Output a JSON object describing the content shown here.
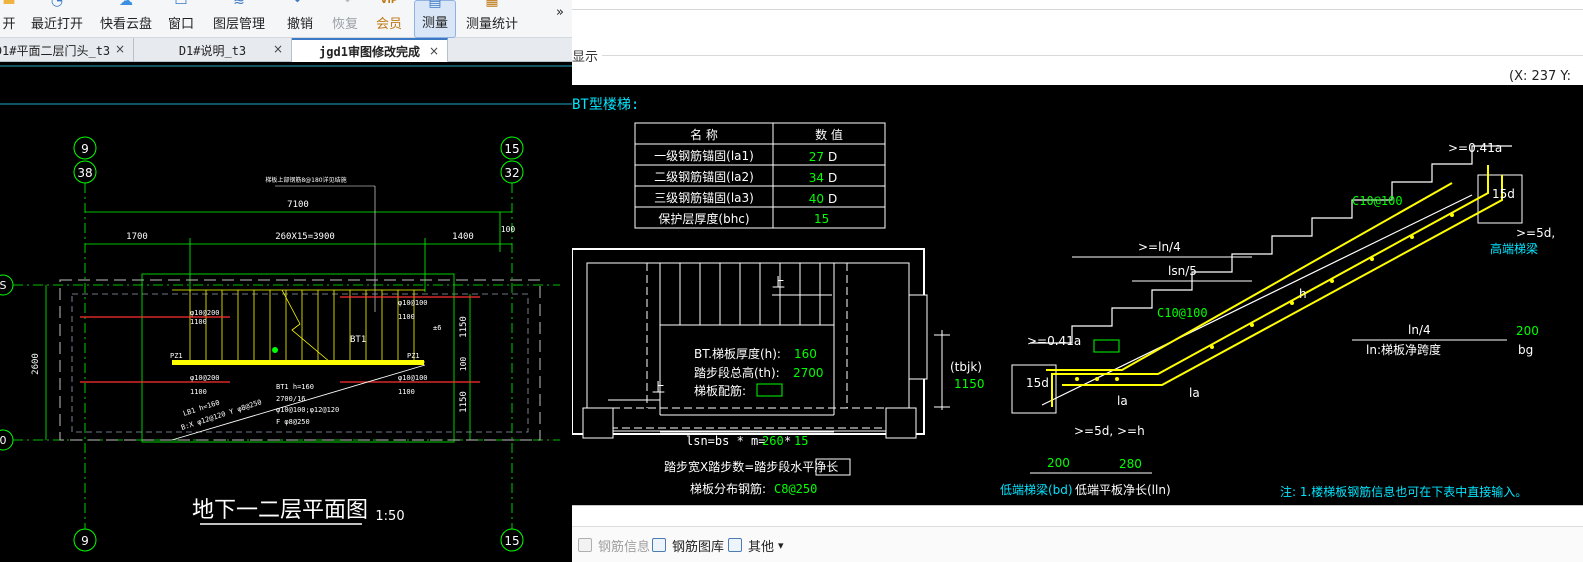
{
  "cad_viewer": {
    "toolbar": {
      "buttons": [
        {
          "id": "open",
          "label": "开",
          "icon": "folder-open-icon"
        },
        {
          "id": "recent",
          "label": "最近打开",
          "icon": "clock-icon"
        },
        {
          "id": "cloud",
          "label": "快看云盘",
          "icon": "cloud-icon"
        },
        {
          "id": "window",
          "label": "窗口",
          "icon": "window-icon"
        },
        {
          "id": "layers",
          "label": "图层管理",
          "icon": "layers-icon"
        },
        {
          "id": "undo",
          "label": "撤销",
          "icon": "undo-icon"
        },
        {
          "id": "redo",
          "label": "恢复",
          "icon": "redo-icon"
        },
        {
          "id": "vip",
          "label": "会员",
          "icon": "vip-badge-icon",
          "badge": "VIP"
        },
        {
          "id": "measure",
          "label": "测量",
          "icon": "ruler-icon"
        },
        {
          "id": "measure_stats",
          "label": "测量统计",
          "icon": "stats-icon"
        }
      ],
      "more": "»"
    },
    "tabs": [
      {
        "label": "D1#平面二层门头_t3",
        "close": "×"
      },
      {
        "label": "D1#说明_t3",
        "close": "×"
      },
      {
        "label": "jgd1审图修改完成",
        "close": "×"
      }
    ],
    "drawing": {
      "axis_top": [
        "9",
        "38",
        "15",
        "32"
      ],
      "axis_left": [
        "S",
        "0"
      ],
      "axis_bottom": [
        "9",
        "15"
      ],
      "dims_top": [
        "7100",
        "1700",
        "260X15=3900",
        "1400",
        "100"
      ],
      "dims_right": [
        "1150",
        "100",
        "1150"
      ],
      "dim_left": "2600",
      "note_top": "梯板上部钢筋8@180详见结施",
      "labels": [
        "φ10@200",
        "1100",
        "φ10@100",
        "1100",
        "φ10@200",
        "1100",
        "φ10@100",
        "1100",
        "BT1",
        "BT1 h=160",
        "2700/16",
        "φ10@100;φ12@120",
        "F φ8@250",
        "LB1 h=160",
        "B:X φ12@120 Y φ8@250",
        "PZ1",
        "PZ1",
        "±6"
      ],
      "plan_title": "地下一二层平面图",
      "plan_scale": "1:50"
    }
  },
  "stair_dialog": {
    "display_label": "显示",
    "coord_readout": "(X: 237 Y:",
    "title": "BT型楼梯:",
    "table": {
      "headers": [
        "名  称",
        "数  值"
      ],
      "rows": [
        {
          "name": "一级钢筋锚固(la1)",
          "value": "27",
          "unit": "D"
        },
        {
          "name": "二级钢筋锚固(la2)",
          "value": "34",
          "unit": "D"
        },
        {
          "name": "三级钢筋锚固(la3)",
          "value": "40",
          "unit": "D"
        },
        {
          "name": "保护层厚度(bhc)",
          "value": "15",
          "unit": ""
        }
      ]
    },
    "plan": {
      "up_labels": [
        "上",
        "上"
      ],
      "thickness_label": "BT.梯板厚度(h):",
      "thickness_value": "160",
      "total_height_label": "踏步段总高(th):",
      "total_height_value": "2700",
      "rebar_label": "梯板配筋:",
      "tbjk_label": "(tbjk)",
      "tbjk_value": "1150",
      "lsn_prefix": "lsn=bs * m=",
      "lsn_bs": "260",
      "lsn_mid": "* ",
      "lsn_m": "15",
      "formula": "踏步宽X踏步数=踏步段水平净长",
      "dist_label": "梯板分布钢筋:",
      "dist_value": "C8@250"
    },
    "section": {
      "rebar_top": "C10@100",
      "rebar_mid": "C10@100",
      "label_ln4_left": ">=ln/4",
      "label_lsn5": "lsn/5",
      "label_041a_top": ">=0.41a",
      "label_041a_left": ">=0.41a",
      "label_15d_left": "15d",
      "label_15d_right": "15d",
      "label_5d_right": ">=5d,",
      "label_5d_bottom": ">=5d, >=h",
      "label_h": "h",
      "label_la1": "la",
      "label_la2": "la",
      "high_beam": "高端梯梁",
      "ln4_right": "ln/4",
      "bg_value": "200",
      "bg_label": "bg",
      "ln_label": "ln:梯板净跨度",
      "bd_value": "200",
      "lln_value": "280",
      "low_beam": "低端梯梁(bd)",
      "low_slab": "低端平板净长(lln)",
      "note": "注: 1.楼梯板钢筋信息也可在下表中直接输入。"
    },
    "bottom_bar": [
      {
        "label": "钢筋信息",
        "disabled": true
      },
      {
        "label": "钢筋图库",
        "disabled": false
      },
      {
        "label": "其他",
        "disabled": false,
        "dropdown": "▾"
      }
    ]
  },
  "colors": {
    "cad_bg": "#000000",
    "green": "#00ff00",
    "yellow": "#ffff00",
    "cyan": "#00e5ff",
    "red": "#ff3030",
    "white": "#ffffff",
    "active_tab_accent": "#3b79c4"
  }
}
